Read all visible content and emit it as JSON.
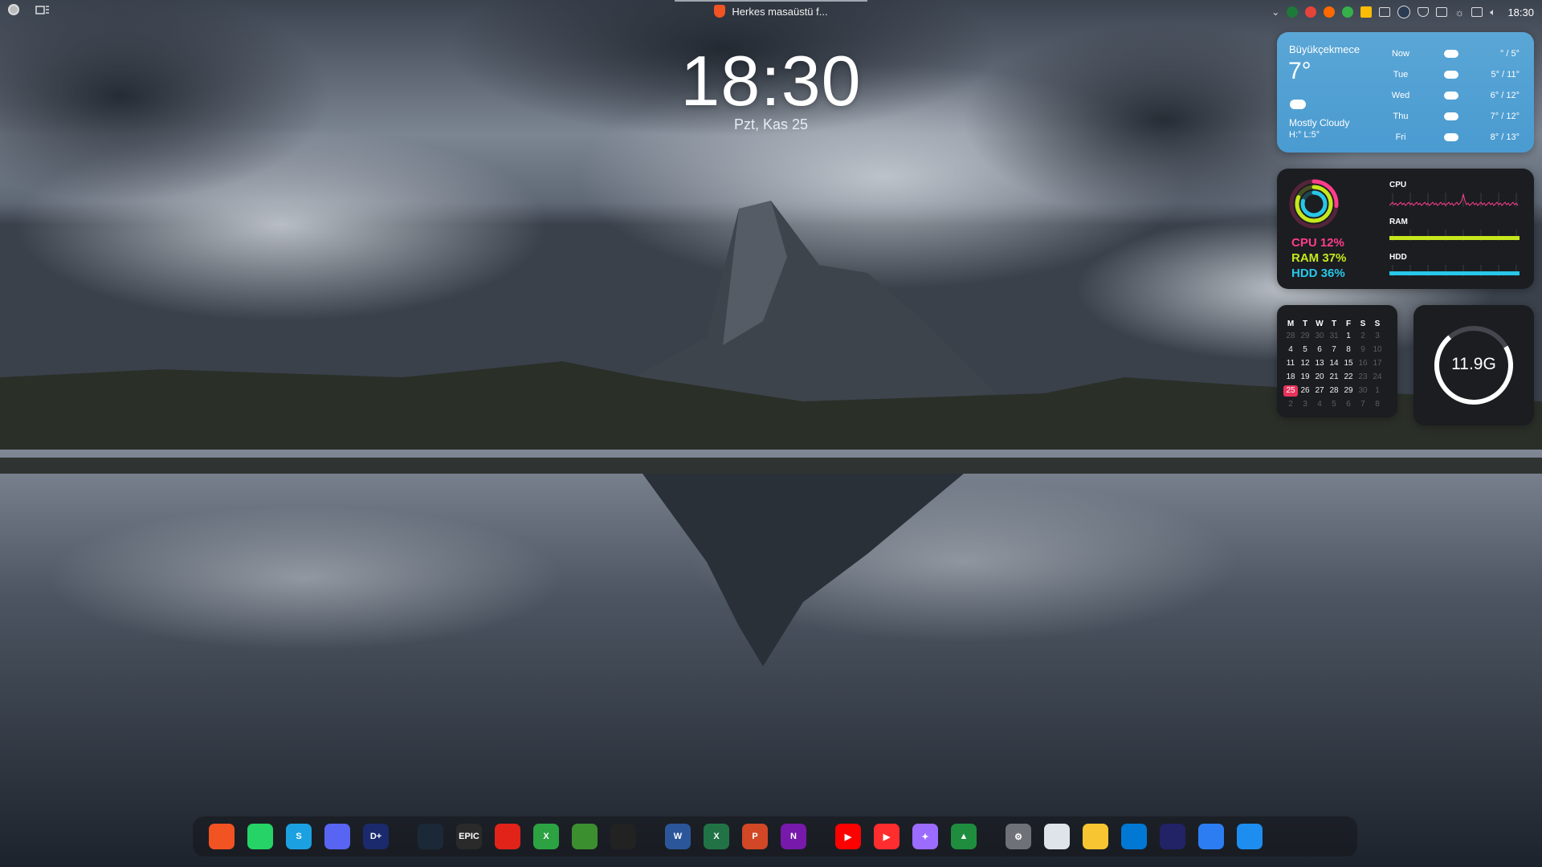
{
  "topbar": {
    "window_title": "Herkes masaüstü f...",
    "clock": "18:30"
  },
  "lock": {
    "time": "18:30",
    "date": "Pzt, Kas 25"
  },
  "weather": {
    "city": "Büyükçekmece",
    "temp": "7°",
    "condition": "Mostly Cloudy",
    "high_low": "H:° L:5°",
    "forecast": [
      {
        "day": "Now",
        "temps": "° / 5°"
      },
      {
        "day": "Tue",
        "temps": "5° / 11°"
      },
      {
        "day": "Wed",
        "temps": "6° / 12°"
      },
      {
        "day": "Thu",
        "temps": "7° / 12°"
      },
      {
        "day": "Fri",
        "temps": "8° / 13°"
      }
    ]
  },
  "sysmon": {
    "cpu": "CPU 12%",
    "ram": "RAM 37%",
    "hdd": "HDD 36%",
    "cpu_label": "CPU",
    "ram_label": "RAM",
    "hdd_label": "HDD",
    "colors": {
      "cpu": "#ff3d8b",
      "ram": "#c6e81c",
      "hdd": "#28c7e8"
    },
    "cpu_fraction": 0.12,
    "ram_fraction": 0.37,
    "hdd_fraction": 0.36
  },
  "calendar": {
    "headers": [
      "M",
      "T",
      "W",
      "T",
      "F",
      "S",
      "S"
    ],
    "days": [
      {
        "d": "28",
        "dim": true
      },
      {
        "d": "29",
        "dim": true
      },
      {
        "d": "30",
        "dim": true
      },
      {
        "d": "31",
        "dim": true
      },
      {
        "d": "1"
      },
      {
        "d": "2",
        "dim": true
      },
      {
        "d": "3",
        "dim": true
      },
      {
        "d": "4"
      },
      {
        "d": "5"
      },
      {
        "d": "6"
      },
      {
        "d": "7"
      },
      {
        "d": "8"
      },
      {
        "d": "9",
        "dim": true
      },
      {
        "d": "10",
        "dim": true
      },
      {
        "d": "11"
      },
      {
        "d": "12"
      },
      {
        "d": "13"
      },
      {
        "d": "14"
      },
      {
        "d": "15"
      },
      {
        "d": "16",
        "dim": true
      },
      {
        "d": "17",
        "dim": true
      },
      {
        "d": "18"
      },
      {
        "d": "19"
      },
      {
        "d": "20"
      },
      {
        "d": "21"
      },
      {
        "d": "22"
      },
      {
        "d": "23",
        "dim": true
      },
      {
        "d": "24",
        "dim": true
      },
      {
        "d": "25",
        "today": true
      },
      {
        "d": "26"
      },
      {
        "d": "27"
      },
      {
        "d": "28"
      },
      {
        "d": "29"
      },
      {
        "d": "30",
        "dim": true
      },
      {
        "d": "1",
        "dim": true
      },
      {
        "d": "2",
        "dim": true
      },
      {
        "d": "3",
        "dim": true
      },
      {
        "d": "4",
        "dim": true
      },
      {
        "d": "5",
        "dim": true
      },
      {
        "d": "6",
        "dim": true
      },
      {
        "d": "7",
        "dim": true
      },
      {
        "d": "8",
        "dim": true
      }
    ]
  },
  "storage": {
    "value": "11.9G",
    "fraction": 0.72
  },
  "dock": {
    "groups": [
      [
        {
          "name": "brave",
          "color": "#f25322",
          "label": ""
        },
        {
          "name": "whatsapp",
          "color": "#25d366",
          "label": ""
        },
        {
          "name": "skype",
          "color": "#1ba1e2",
          "label": "S"
        },
        {
          "name": "discord",
          "color": "#5865f2",
          "label": ""
        },
        {
          "name": "disney-plus",
          "color": "#1a2a6c",
          "label": "D+"
        }
      ],
      [
        {
          "name": "steam",
          "color": "#1b2838",
          "label": ""
        },
        {
          "name": "epic-games",
          "color": "#2a2a2a",
          "label": "EPIC"
        },
        {
          "name": "roblox",
          "color": "#e2231a",
          "label": ""
        },
        {
          "name": "xbox",
          "color": "#2ca243",
          "label": "X"
        },
        {
          "name": "minecraft",
          "color": "#3c8f2f",
          "label": ""
        },
        {
          "name": "app-grid",
          "color": "#222222",
          "label": ""
        }
      ],
      [
        {
          "name": "word",
          "color": "#2b579a",
          "label": "W"
        },
        {
          "name": "excel",
          "color": "#217346",
          "label": "X"
        },
        {
          "name": "powerpoint",
          "color": "#d24726",
          "label": "P"
        },
        {
          "name": "onenote",
          "color": "#7719aa",
          "label": "N"
        }
      ],
      [
        {
          "name": "youtube",
          "color": "#ff0000",
          "label": "▶"
        },
        {
          "name": "youtube-music",
          "color": "#ff2d2d",
          "label": "▶"
        },
        {
          "name": "gemini",
          "color": "#9c6bff",
          "label": "✦"
        },
        {
          "name": "google-drive",
          "color": "#1e8e3e",
          "label": "▲"
        }
      ],
      [
        {
          "name": "settings",
          "color": "#6e7178",
          "label": "⚙"
        },
        {
          "name": "control-panel",
          "color": "#dfe3ea",
          "label": ""
        },
        {
          "name": "file-explorer",
          "color": "#f7c531",
          "label": ""
        },
        {
          "name": "microsoft-store",
          "color": "#0078d4",
          "label": ""
        },
        {
          "name": "artstudio",
          "color": "#222266",
          "label": ""
        },
        {
          "name": "airdrop",
          "color": "#2c7df2",
          "label": ""
        },
        {
          "name": "split-view",
          "color": "#1d8ef0",
          "label": ""
        }
      ]
    ]
  }
}
